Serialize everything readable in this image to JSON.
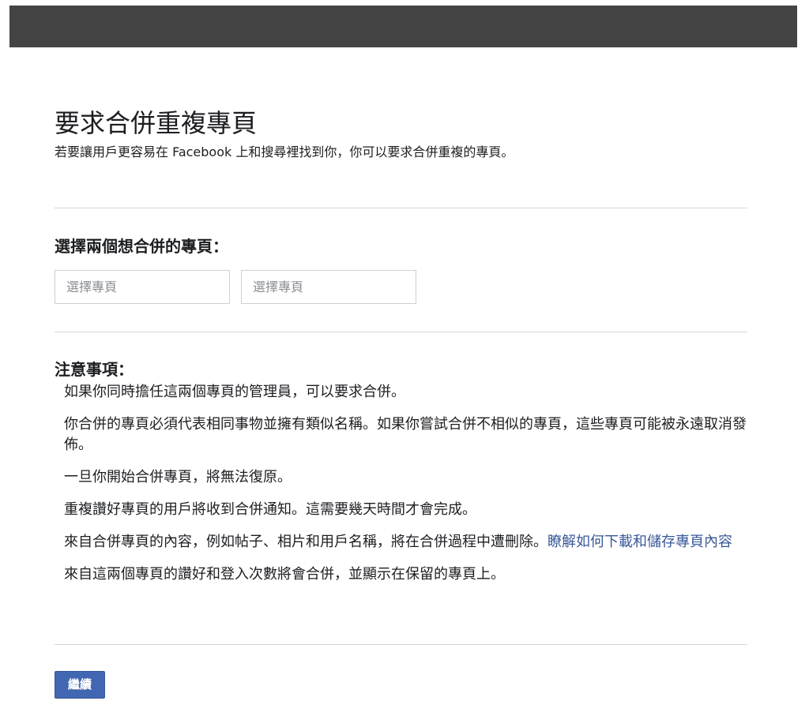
{
  "header": {
    "title": "要求合併重複專頁",
    "subtitle": "若要讓用戶更容易在 Facebook 上和搜尋裡找到你，你可以要求合併重複的專頁。"
  },
  "select_section": {
    "label": "選擇兩個想合併的專頁：",
    "page_selectors": [
      {
        "placeholder": "選擇專頁"
      },
      {
        "placeholder": "選擇專頁"
      }
    ]
  },
  "notes_section": {
    "label": "注意事項：",
    "items": [
      {
        "text": "如果你同時擔任這兩個專頁的管理員，可以要求合併。"
      },
      {
        "text": "你合併的專頁必須代表相同事物並擁有類似名稱。如果你嘗試合併不相似的專頁，這些專頁可能被永遠取消發佈。"
      },
      {
        "text": "一旦你開始合併專頁，將無法復原。"
      },
      {
        "text": "重複讚好專頁的用戶將收到合併通知。這需要幾天時間才會完成。"
      },
      {
        "text": "來自合併專頁的內容，例如帖子、相片和用戶名稱，將在合併過程中遭刪除。",
        "link": "瞭解如何下載和儲存專頁內容"
      },
      {
        "text": "來自這兩個專頁的讚好和登入次數將會合併，並顯示在保留的專頁上。"
      }
    ]
  },
  "footer": {
    "continue_label": "繼續"
  },
  "colors": {
    "topbar": "#444444",
    "link": "#385898",
    "button": "#4267b2"
  }
}
